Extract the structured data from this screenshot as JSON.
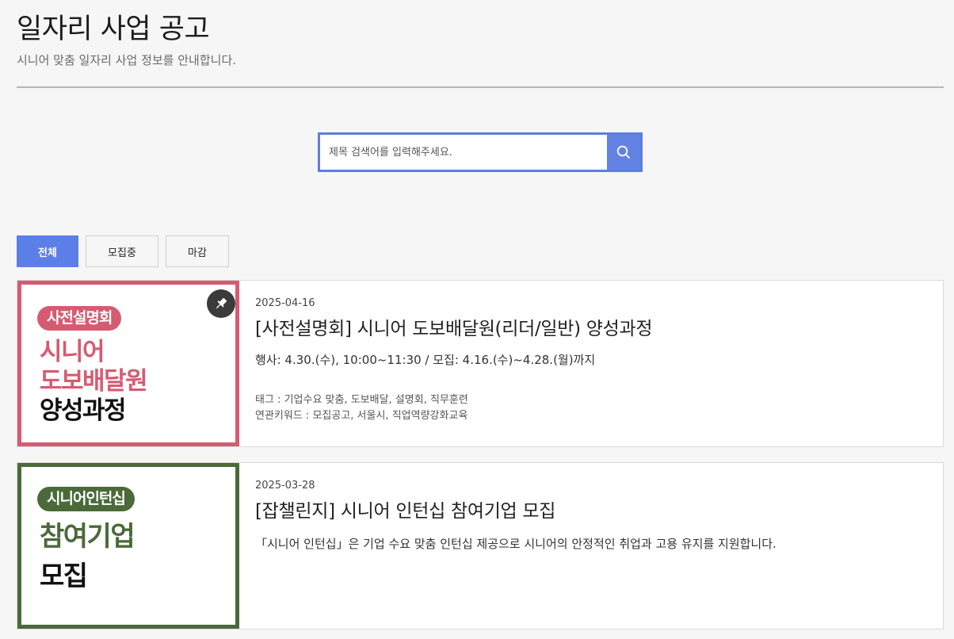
{
  "header": {
    "title": "일자리 사업 공고",
    "subtitle": "시니어 맞춤 일자리 사업 정보를 안내합니다."
  },
  "search": {
    "placeholder": "제목 검색어를 입력해주세요.",
    "value": "",
    "button_icon": "search-icon"
  },
  "filters": [
    {
      "label": "전체",
      "active": true
    },
    {
      "label": "모집중",
      "active": false
    },
    {
      "label": "마감",
      "active": false
    }
  ],
  "posts": [
    {
      "pinned": true,
      "thumbnail": {
        "badge": "사전설명회",
        "line1": "시니어",
        "line2": "도보배달원",
        "line3": "양성과정",
        "color": "#d65b71"
      },
      "date": "2025-04-16",
      "title": "[사전설명회] 시니어 도보배달원(리더/일반) 양성과정",
      "desc": "행사: 4.30.(수), 10:00~11:30 / 모집: 4.16.(수)~4.28.(월)까지",
      "tags": "태그 :  기업수요 맞춤,  도보배달,  설명회,  직무훈련",
      "keywords": "연관키워드 :  모집공고,  서울시,  직업역량강화교육"
    },
    {
      "pinned": false,
      "thumbnail": {
        "badge": "시니어인턴십",
        "line1": "참여기업",
        "line2": "모집",
        "color": "#4a6a3a"
      },
      "date": "2025-03-28",
      "title": "[잡챌린지] 시니어 인턴십 참여기업 모집",
      "desc": "「시니어 인턴십」은 기업 수요 맞춤 인턴십 제공으로 시니어의 안정적인 취업과 고용 유지를 지원합니다."
    }
  ],
  "colors": {
    "accent": "#5b7fe6",
    "pink": "#d65b71",
    "green": "#4a6a3a"
  }
}
